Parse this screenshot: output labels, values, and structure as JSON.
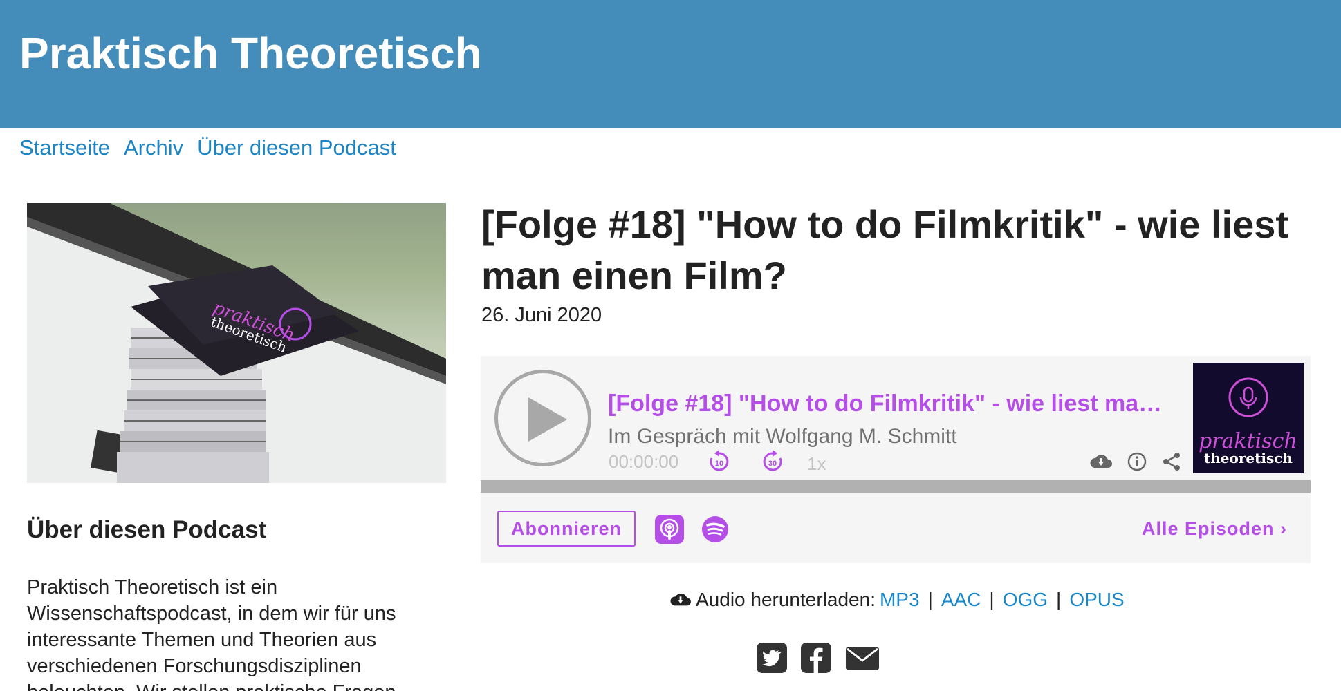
{
  "site": {
    "title": "Praktisch Theoretisch"
  },
  "nav": {
    "items": [
      "Startseite",
      "Archiv",
      "Über diesen Podcast"
    ]
  },
  "sidebar": {
    "heading": "Über diesen Podcast",
    "text": "Praktisch Theoretisch ist ein Wissenschaftspodcast, in dem wir für uns interessante Themen und Theorien aus verschiedenen Forschungsdisziplinen beleuchten. Wir stellen praktische Fragen",
    "hero_card": {
      "word1": "praktisch",
      "word2": "theoretisch"
    }
  },
  "episode": {
    "title": "[Folge #18] \"How to do Filmkritik\" - wie liest man einen Film?",
    "date": "26. Juni 2020"
  },
  "player": {
    "title": "[Folge #18] \"How to do Filmkritik\" - wie liest man einen Film?",
    "subtitle": "Im Gespräch mit Wolfgang M. Schmitt",
    "time": "00:00:00",
    "skip_back": "10",
    "skip_forward": "30",
    "speed": "1x",
    "progress": 0,
    "cover": {
      "word1": "praktisch",
      "word2": "theoretisch"
    },
    "subscribe_label": "Abonnieren",
    "all_episodes_label": "Alle Episoden ›",
    "accent_color": "#b44ee6"
  },
  "download": {
    "label": "Audio herunterladen:",
    "formats": [
      "MP3",
      "AAC",
      "OGG",
      "OPUS"
    ]
  },
  "colors": {
    "header": "#448cba",
    "link": "#1a86c8"
  }
}
